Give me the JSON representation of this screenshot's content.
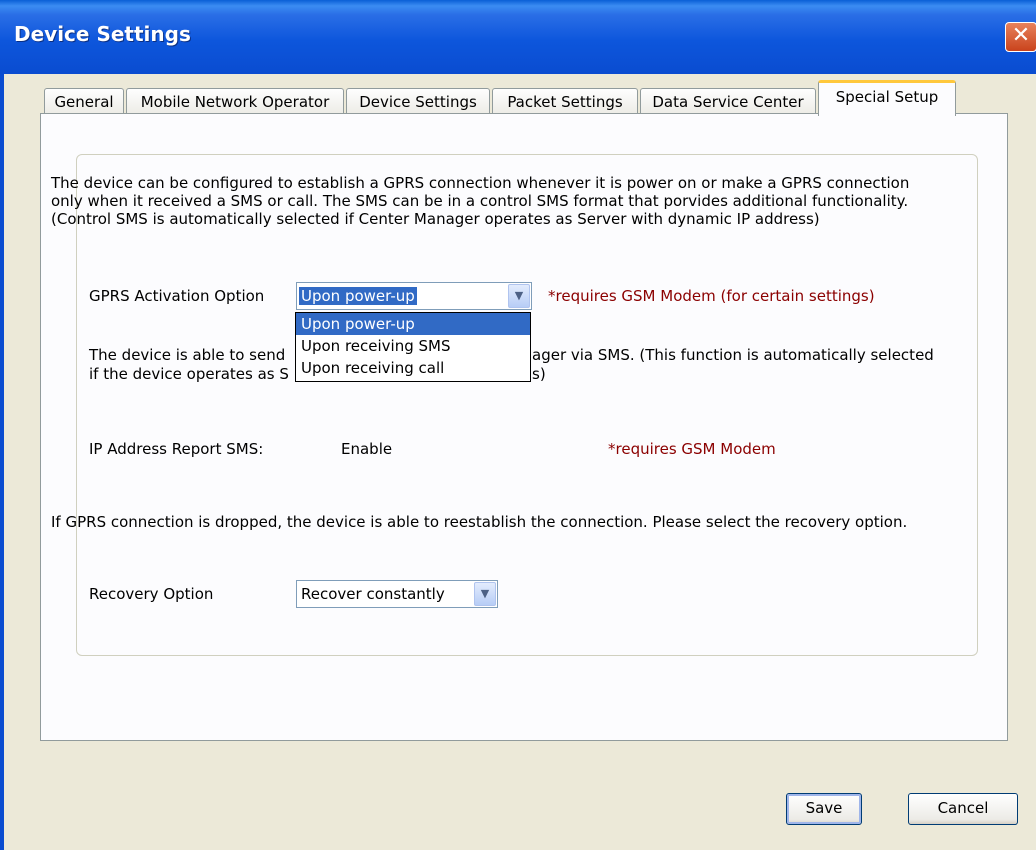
{
  "window": {
    "title": "Device Settings",
    "close_glyph": "✕"
  },
  "tabs": [
    {
      "label": "General",
      "active": false
    },
    {
      "label": "Mobile Network Operator",
      "active": false
    },
    {
      "label": "Device Settings",
      "active": false
    },
    {
      "label": "Packet Settings",
      "active": false
    },
    {
      "label": "Data Service Center",
      "active": false
    },
    {
      "label": "Special Setup",
      "active": true
    }
  ],
  "special_setup": {
    "gprs_description": "The device can be configured to establish a GPRS connection whenever it is power on or make a GPRS connection only when it received a SMS or call. The SMS can be in a control SMS format that porvides additional functionality. (Control SMS is automatically selected if Center Manager operates as Server with dynamic IP address)",
    "gprs_activation": {
      "label": "GPRS Activation Option",
      "selected": "Upon power-up",
      "options": [
        "Upon power-up",
        "Upon receiving SMS",
        "Upon receiving call"
      ],
      "note": "*requires GSM Modem (for certain settings)"
    },
    "ip_report_description": {
      "line1_start": "The device is able to send",
      "line1_end": "ager via SMS. (This function is automatically selected",
      "line2_start": "if the device operates as S",
      "line2_end": "s)"
    },
    "ip_address_report": {
      "label": "IP Address Report SMS:",
      "value": "Enable",
      "note": "*requires GSM Modem"
    },
    "recovery_description": "If GPRS connection is dropped, the device is able to reestablish the connection. Please select the recovery option.",
    "recovery": {
      "label": "Recovery Option",
      "selected": "Recover constantly"
    }
  },
  "buttons": {
    "save": "Save",
    "cancel": "Cancel"
  },
  "colors": {
    "title_bar": "#0a4cd0",
    "warning_text": "#8b0000",
    "selection": "#316ac5"
  }
}
